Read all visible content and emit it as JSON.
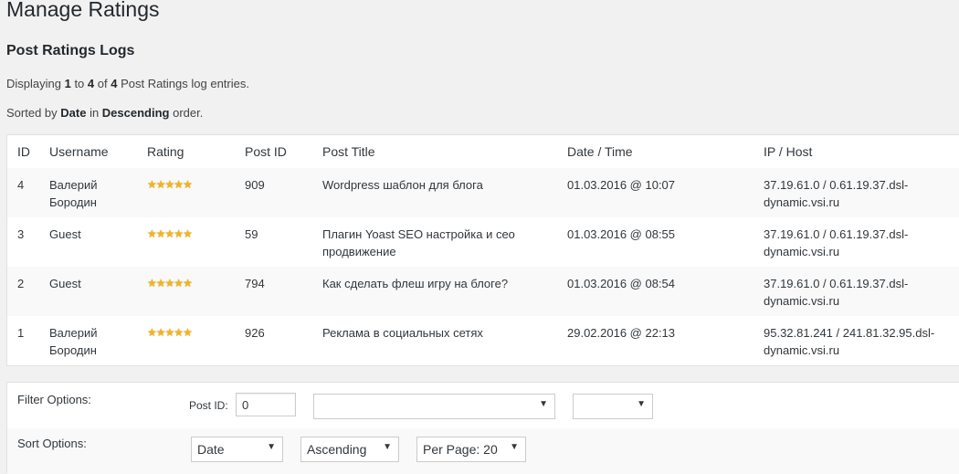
{
  "page": {
    "title": "Manage Ratings",
    "section_title": "Post Ratings Logs"
  },
  "summary": {
    "display_prefix": "Displaying ",
    "display_from": "1",
    "display_to_word": " to ",
    "display_to": "4",
    "display_of_word": " of ",
    "display_total": "4",
    "display_suffix": " Post Ratings log entries.",
    "sort_prefix": "Sorted by ",
    "sort_field": "Date",
    "sort_in": " in ",
    "sort_order": "Descending",
    "sort_suffix": " order."
  },
  "table": {
    "columns": [
      "ID",
      "Username",
      "Rating",
      "Post ID",
      "Post Title",
      "Date / Time",
      "IP / Host"
    ],
    "rows": [
      {
        "id": "4",
        "username_l1": "Валерий",
        "username_l2": "Бородин",
        "rating": 5,
        "post_id": "909",
        "title_l1": "Wordpress шаблон для блога",
        "title_l2": "",
        "datetime": "01.03.2016 @ 10:07",
        "ip_l1": "37.19.61.0 / 0.61.19.37.dsl-",
        "ip_l2": "dynamic.vsi.ru"
      },
      {
        "id": "3",
        "username_l1": "Guest",
        "username_l2": "",
        "rating": 5,
        "post_id": "59",
        "title_l1": "Плагин Yoast SEO настройка и сео",
        "title_l2": "продвижение",
        "datetime": "01.03.2016 @ 08:55",
        "ip_l1": "37.19.61.0 / 0.61.19.37.dsl-",
        "ip_l2": "dynamic.vsi.ru"
      },
      {
        "id": "2",
        "username_l1": "Guest",
        "username_l2": "",
        "rating": 5,
        "post_id": "794",
        "title_l1": "Как сделать флеш игру на блоге?",
        "title_l2": "",
        "datetime": "01.03.2016 @ 08:54",
        "ip_l1": "37.19.61.0 / 0.61.19.37.dsl-",
        "ip_l2": "dynamic.vsi.ru"
      },
      {
        "id": "1",
        "username_l1": "Валерий",
        "username_l2": "Бородин",
        "rating": 5,
        "post_id": "926",
        "title_l1": "Реклама в социальных сетях",
        "title_l2": "",
        "datetime": "29.02.2016 @ 22:13",
        "ip_l1": "95.32.81.241 / 241.81.32.95.dsl-",
        "ip_l2": "dynamic.vsi.ru"
      }
    ]
  },
  "filters": {
    "filter_label": "Filter Options:",
    "post_id_label": "Post ID:",
    "post_id_value": "0",
    "post_select_value": "",
    "third_select_value": "",
    "sort_label": "Sort Options:",
    "sort_by_value": "Date",
    "sort_order_value": "Ascending",
    "per_page_value": "Per Page: 20"
  },
  "icons": {
    "star": "star-icon",
    "dropdown": "chevron-down-icon"
  },
  "colors": {
    "star": "#f3b41c",
    "background": "#f1f1f1"
  }
}
